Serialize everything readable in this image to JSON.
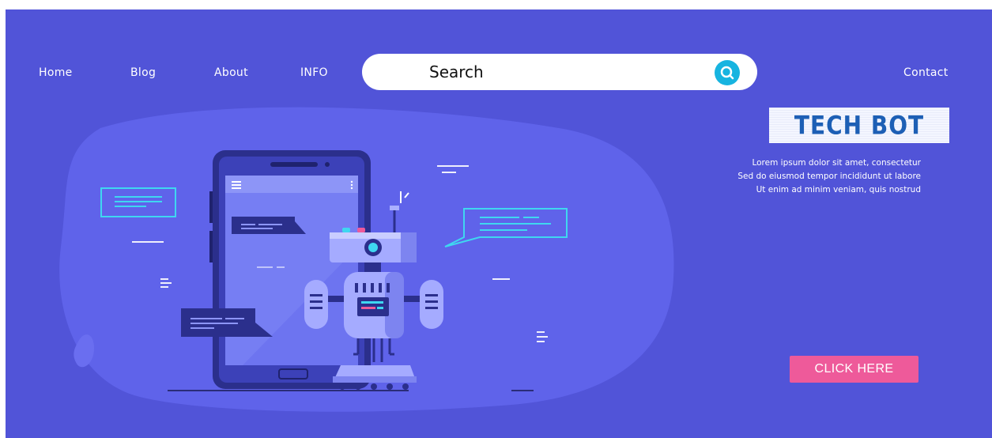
{
  "nav": {
    "home": "Home",
    "blog": "Blog",
    "about": "About",
    "info": "INFO",
    "contact": "Contact"
  },
  "search": {
    "placeholder": "Search"
  },
  "hero": {
    "logo_text": "TECH BOT",
    "lines": [
      "Lorem ipsum dolor sit amet, consectetur",
      "Sed do eiusmod tempor incididunt ut labore",
      "Ut enim ad minim veniam, quis nostrud"
    ],
    "cta_label": "CLICK HERE"
  },
  "colors": {
    "background": "#5154d8",
    "blob": "#5f63ea",
    "accent_cyan": "#17b4e0",
    "cta": "#ee5a9a",
    "logo_text": "#1d5fb5"
  }
}
